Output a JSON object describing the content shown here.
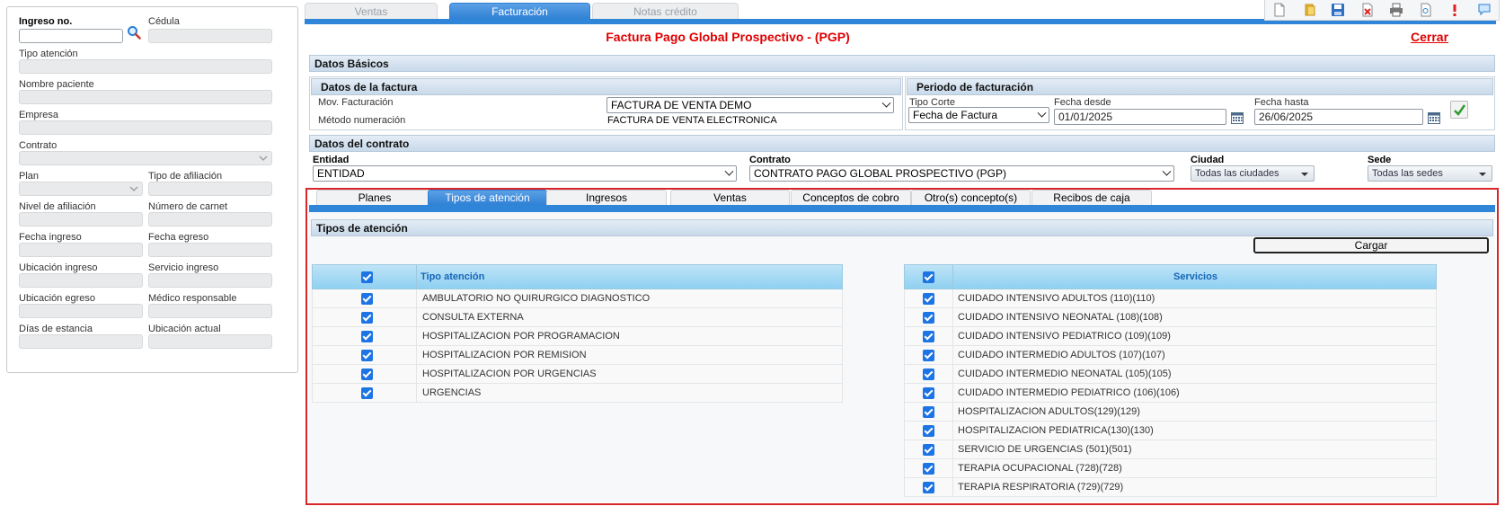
{
  "left_panel": {
    "ingreso_label": "Ingreso no.",
    "cedula_label": "Cédula",
    "tipo_atencion_label": "Tipo atención",
    "nombre_paciente_label": "Nombre paciente",
    "empresa_label": "Empresa",
    "contrato_label": "Contrato",
    "plan_label": "Plan",
    "tipo_afiliacion_label": "Tipo de afiliación",
    "nivel_afiliacion_label": "Nivel de afiliación",
    "numero_carnet_label": "Número de carnet",
    "fecha_ingreso_label": "Fecha ingreso",
    "fecha_egreso_label": "Fecha egreso",
    "ubicacion_ingreso_label": "Ubicación ingreso",
    "servicio_ingreso_label": "Servicio ingreso",
    "ubicacion_egreso_label": "Ubicación egreso",
    "medico_responsable_label": "Médico responsable",
    "dias_estancia_label": "Días de estancia",
    "ubicacion_actual_label": "Ubicación actual"
  },
  "main_tabs": [
    {
      "label": "Ventas"
    },
    {
      "label": "Facturación"
    },
    {
      "label": "Notas crédito"
    }
  ],
  "toolbar": {
    "icons": [
      "new-document-icon",
      "open-folder-icon",
      "save-icon",
      "delete-icon",
      "print-icon",
      "preview-icon",
      "alert-icon",
      "help-chat-icon"
    ]
  },
  "title": "Factura Pago Global Prospectivo - (PGP)",
  "close_label": "Cerrar",
  "datos_basicos": {
    "header": "Datos Básicos",
    "datos_factura_header": "Datos de la factura",
    "mov_facturacion_label": "Mov. Facturación",
    "mov_facturacion_value": "FACTURA DE VENTA DEMO",
    "metodo_numeracion_label": "Método numeración",
    "metodo_numeracion_value": "FACTURA DE VENTA ELECTRONICA",
    "periodo_header": "Periodo de facturación",
    "tipo_corte_label": "Tipo Corte",
    "tipo_corte_value": "Fecha de Factura",
    "fecha_desde_label": "Fecha desde",
    "fecha_desde_value": "01/01/2025",
    "fecha_hasta_label": "Fecha hasta",
    "fecha_hasta_value": "26/06/2025"
  },
  "datos_contrato": {
    "header": "Datos del contrato",
    "entidad_label": "Entidad",
    "entidad_value": "ENTIDAD",
    "contrato_label": "Contrato",
    "contrato_value": "CONTRATO PAGO GLOBAL PROSPECTIVO (PGP)",
    "ciudad_label": "Ciudad",
    "ciudad_value": "Todas las ciudades",
    "sede_label": "Sede",
    "sede_value": "Todas las sedes"
  },
  "sub_tabs": [
    {
      "label": "Planes"
    },
    {
      "label": "Tipos de atención"
    },
    {
      "label": "Ingresos"
    },
    {
      "label": "Ventas"
    },
    {
      "label": "Conceptos de cobro"
    },
    {
      "label": "Otro(s) concepto(s)"
    },
    {
      "label": "Recibos de caja"
    }
  ],
  "tipos_atencion": {
    "section_header": "Tipos de atención",
    "load_button": "Cargar",
    "left_grid_header": "Tipo atención",
    "left_rows": [
      "AMBULATORIO NO QUIRURGICO DIAGNOSTICO",
      "CONSULTA EXTERNA",
      "HOSPITALIZACION POR PROGRAMACION",
      "HOSPITALIZACION POR REMISION",
      "HOSPITALIZACION POR URGENCIAS",
      "URGENCIAS"
    ],
    "right_grid_header": "Servicios",
    "right_rows": [
      "CUIDADO INTENSIVO ADULTOS (110)(110)",
      "CUIDADO INTENSIVO NEONATAL (108)(108)",
      "CUIDADO INTENSIVO PEDIATRICO (109)(109)",
      "CUIDADO INTERMEDIO ADULTOS (107)(107)",
      "CUIDADO INTERMEDIO NEONATAL (105)(105)",
      "CUIDADO INTERMEDIO PEDIATRICO (106)(106)",
      "HOSPITALIZACION ADULTOS(129)(129)",
      "HOSPITALIZACION PEDIATRICA(130)(130)",
      "SERVICIO DE URGENCIAS (501)(501)",
      "TERAPIA OCUPACIONAL (728)(728)",
      "TERAPIA RESPIRATORIA (729)(729)"
    ]
  },
  "colors": {
    "accent_blue": "#2f86d8",
    "title_red": "#e00000",
    "frame_red": "#d9262b",
    "grid_header_text": "#1565b8",
    "checkbox_blue": "#1d74e4"
  }
}
